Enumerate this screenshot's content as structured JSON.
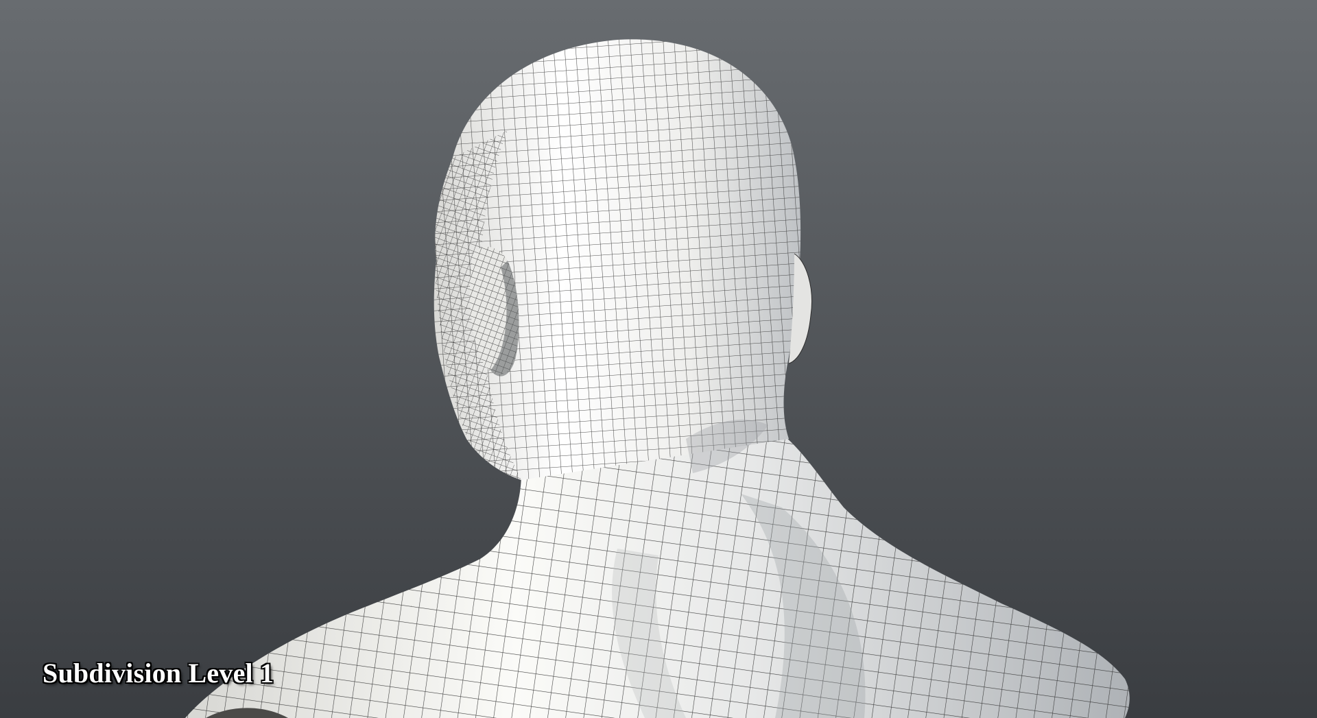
{
  "viewport": {
    "caption": "Subdivision Level 1",
    "background_top": "#686c70",
    "background_bottom": "#3a3d41",
    "mesh_fill": "#f2f2ee",
    "wire_color": "#2b2b2b"
  }
}
